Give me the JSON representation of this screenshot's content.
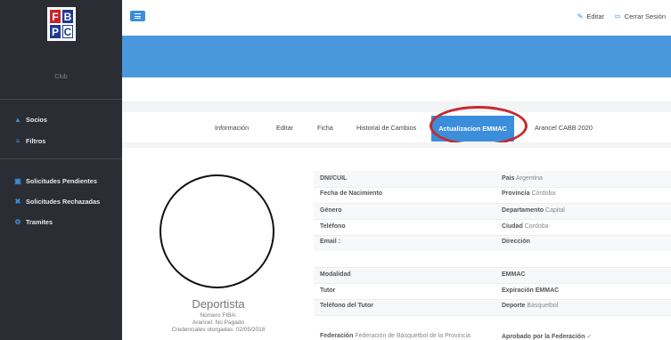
{
  "sidebar": {
    "logo": [
      "F",
      "B",
      "P",
      "C"
    ],
    "club_label": "Club",
    "items": [
      {
        "label": "Socios",
        "icon": "user-icon"
      },
      {
        "label": "Filtros",
        "icon": "filter-icon"
      },
      {
        "label": "Solicitudes Pendientes",
        "icon": "inbox-icon"
      },
      {
        "label": "Solicitudes Rechazadas",
        "icon": "x-icon"
      },
      {
        "label": "Tramites",
        "icon": "gear-icon"
      }
    ]
  },
  "topbar": {
    "edit_label": "Editar",
    "logout_label": "Cerrar Sesión"
  },
  "tabs": {
    "items": [
      "Información",
      "Editar",
      "Ficha",
      "Historial de Cambios",
      "Actualizacion EMMAC",
      "Arancel CABB 2020"
    ],
    "active": "Actualizacion EMMAC"
  },
  "profile": {
    "role": "Deportista",
    "fiba": "Número FIBA:",
    "arancel": "Arancel: No Pagado",
    "credenciales": "Credenciales otorgadas: 02/05/2018"
  },
  "details": {
    "left": [
      {
        "key": "DNI/CUIL",
        "value": ""
      },
      {
        "key": "Fecha de Nacimiento",
        "value": ""
      },
      {
        "key": "Género",
        "value": ""
      },
      {
        "key": "Teléfono",
        "value": ""
      },
      {
        "key": "Email :",
        "value": ""
      },
      {
        "key": "Modalidad",
        "value": ""
      },
      {
        "key": "Tutor",
        "value": ""
      },
      {
        "key": "Teléfono del Tutor",
        "value": ""
      },
      {
        "key": "Federación",
        "value": "Federación de Básquetbol de la Provincia"
      }
    ],
    "right": [
      {
        "key": "Pais",
        "value": "Argentina"
      },
      {
        "key": "Provincia",
        "value": "Córdoba"
      },
      {
        "key": "Departamento",
        "value": "Capital"
      },
      {
        "key": "Ciudad",
        "value": "Cordoba"
      },
      {
        "key": "Dirección",
        "value": ""
      },
      {
        "key": "EMMAC",
        "value": ""
      },
      {
        "key": "Expiración EMMAC",
        "value": ""
      },
      {
        "key": "Deporte",
        "value": "Básquetbol"
      },
      {
        "key": "Aprobado por la Federación",
        "value": "✓"
      }
    ]
  },
  "colors": {
    "sidebar": "#2a2d33",
    "accent": "#3b8edb",
    "annotation": "#c62a2f"
  }
}
